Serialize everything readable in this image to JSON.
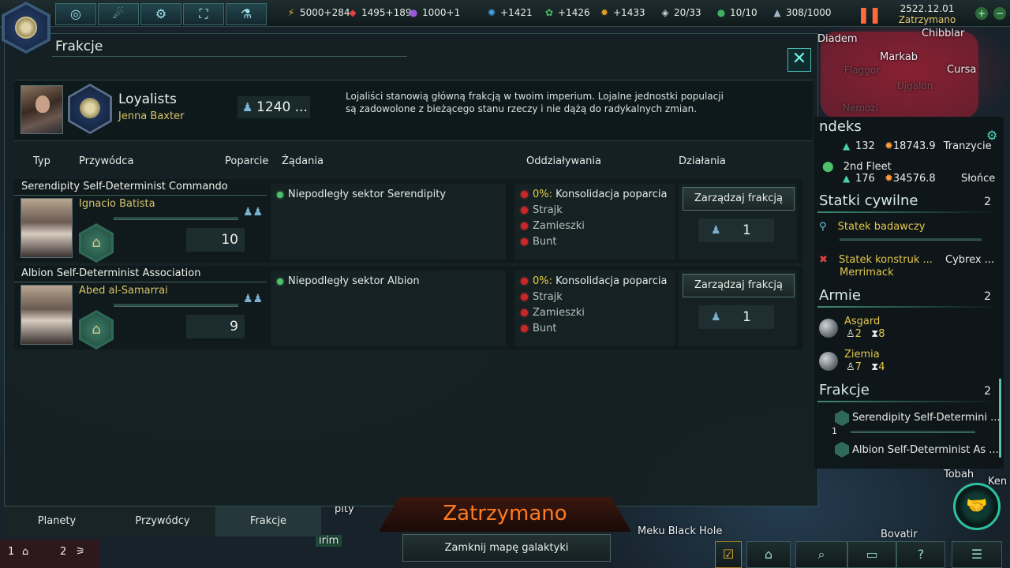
{
  "topbar": {
    "resources": [
      {
        "icon": "energy-icon",
        "glyph": "⚡",
        "value": "5000+284",
        "color": "#e8c020"
      },
      {
        "icon": "minerals-icon",
        "glyph": "◆",
        "value": "1495+189",
        "color": "#e04040"
      },
      {
        "icon": "influence-icon",
        "glyph": "●",
        "value": "1000+1",
        "color": "#9a5ae0"
      },
      {
        "icon": "physics-research-icon",
        "glyph": "✺",
        "value": "+1421",
        "color": "#4aa8e8"
      },
      {
        "icon": "society-research-icon",
        "glyph": "✿",
        "value": "+1426",
        "color": "#40c060"
      },
      {
        "icon": "engineering-research-icon",
        "glyph": "✹",
        "value": "+1433",
        "color": "#e8a020"
      },
      {
        "icon": "starbase-icon",
        "glyph": "◈",
        "value": "20/33",
        "color": "#c8d8e0"
      },
      {
        "icon": "planets-icon",
        "glyph": "●",
        "value": "10/10",
        "color": "#40b060"
      },
      {
        "icon": "fleet-capacity-icon",
        "glyph": "▲",
        "value": "308/1000",
        "color": "#a0b8c8"
      }
    ],
    "date": "2522.12.01",
    "status": "Zatrzymano",
    "nav_buttons": [
      {
        "name": "galaxy-view-button",
        "glyph": "◎"
      },
      {
        "name": "situation-log-button",
        "glyph": "☄"
      },
      {
        "name": "technology-button",
        "glyph": "⚙"
      },
      {
        "name": "planets-map-button",
        "glyph": "⛶"
      },
      {
        "name": "research-button",
        "glyph": "⚗"
      }
    ]
  },
  "window": {
    "title": "Frakcje",
    "main_faction": {
      "name": "Loyalists",
      "leader": "Jenna Baxter",
      "population": "1240 ...",
      "description": "Lojaliści stanowią główną frakcją w twoim imperium. Lojalne jednostki populacji są zadowolone z bieżącego stanu rzeczy i nie dążą do radykalnych zmian."
    },
    "columns": {
      "type": "Typ",
      "leader": "Przywódca",
      "support": "Poparcie",
      "demands": "Żądania",
      "effects": "Oddziaływania",
      "actions": "Działania"
    },
    "factions": [
      {
        "title": "Serendipity Self-Determinist Commando",
        "leader": "Ignacio Batista",
        "support": "10",
        "demand": "Niepodległy sektor Serendipity",
        "effect_pct": "0%:",
        "effects": [
          "Konsolidacja poparcia",
          "Strajk",
          "Zamieszki",
          "Bunt"
        ],
        "manage_label": "Zarządzaj frakcją",
        "manage_count": "1"
      },
      {
        "title": "Albion Self-Determinist Association",
        "leader": "Abed al-Samarrai",
        "support": "9",
        "demand": "Niepodległy sektor Albion",
        "effect_pct": "0%:",
        "effects": [
          "Konsolidacja poparcia",
          "Strajk",
          "Zamieszki",
          "Bunt"
        ],
        "manage_label": "Zarządzaj frakcją",
        "manage_count": "1"
      }
    ]
  },
  "tabs": [
    "Planety",
    "Przywódcy",
    "Frakcje"
  ],
  "paused_banner": "Zatrzymano",
  "close_map_label": "Zamknij mapę galaktyki",
  "outliner": {
    "partial_title": "ndeks",
    "fleet_row1": {
      "count": "132",
      "power": "18743.9",
      "location": "Tranzycie"
    },
    "fleet_row2": {
      "name": "2nd Fleet",
      "count": "176",
      "power": "34576.8",
      "location": "Słońce"
    },
    "civilian": {
      "title": "Statki cywilne",
      "count": "2",
      "items": [
        {
          "name": "Statek badawczy"
        },
        {
          "name": "Statek konstruk ...",
          "location": "Cybrex ...",
          "sub": "Merrimack"
        }
      ]
    },
    "armies": {
      "title": "Armie",
      "count": "2",
      "items": [
        {
          "name": "Asgard",
          "units": "2",
          "time": "8"
        },
        {
          "name": "Ziemia",
          "units": "7",
          "time": "4"
        }
      ]
    },
    "factions": {
      "title": "Frakcje",
      "count": "2",
      "items": [
        {
          "name": "Serendipity Self-Determini ...",
          "num": "1"
        },
        {
          "name": "Albion Self-Determinist As ..."
        }
      ]
    }
  },
  "map_labels": {
    "diadem": "Diadem",
    "chibblar": "Chibblar",
    "markab": "Markab",
    "cursa": "Cursa",
    "nemozi": "Nemozi",
    "meku": "Meku Black Hole",
    "bovatir": "Bovatir",
    "tobah": "Tobah",
    "ken": "Ken",
    "irim": "irim",
    "pity": "pity",
    "ujgalon": "Ujgalon",
    "flagor": "Flaggor"
  },
  "bottom_left": {
    "a": "1",
    "b": "2"
  },
  "colors": {
    "accent": "#47b7b2",
    "gold": "#d8c46a",
    "paused": "#ff7a20"
  }
}
